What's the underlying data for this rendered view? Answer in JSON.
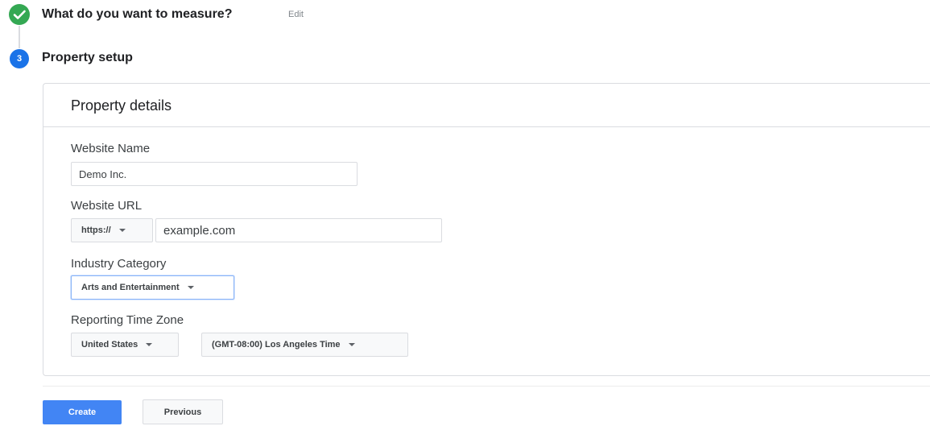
{
  "steps": {
    "completed": {
      "title": "What do you want to measure?",
      "edit_label": "Edit",
      "icon": "check-icon",
      "color": "#34a853"
    },
    "current": {
      "number": "3",
      "title": "Property setup",
      "color": "#1a73e8"
    }
  },
  "card": {
    "title": "Property details",
    "website_name": {
      "label": "Website Name",
      "value": "Demo Inc."
    },
    "website_url": {
      "label": "Website URL",
      "protocol": "https://",
      "value": "example.com"
    },
    "industry_category": {
      "label": "Industry Category",
      "selected": "Arts and Entertainment"
    },
    "reporting_time_zone": {
      "label": "Reporting Time Zone",
      "country": "United States",
      "zone": "(GMT-08:00) Los Angeles Time"
    }
  },
  "actions": {
    "create_label": "Create",
    "previous_label": "Previous",
    "accent_color": "#4285f4"
  }
}
